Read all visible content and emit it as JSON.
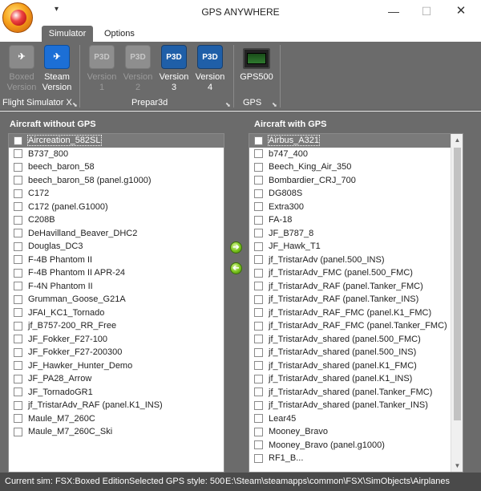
{
  "window": {
    "title": "GPS ANYWHERE",
    "qat_icon": "dropdown-arrow-icon",
    "minimize_icon": "—",
    "maximize_icon": "☐",
    "close_icon": "✕"
  },
  "tabs": [
    {
      "label": "Simulator"
    },
    {
      "label": "Options"
    }
  ],
  "ribbon": {
    "buttons": [
      {
        "label": "Boxed\nVersion",
        "line1": "Boxed",
        "line2": "Version",
        "icon": "plane-icon",
        "enabled": false
      },
      {
        "label": "Steam\nVersion",
        "line1": "Steam",
        "line2": "Version",
        "icon": "plane-icon",
        "enabled": true
      },
      {
        "label": "Version 1",
        "line1": "Version",
        "line2": "1",
        "icon": "p3d-icon",
        "badge": "P3D",
        "enabled": false
      },
      {
        "label": "Version 2",
        "line1": "Version",
        "line2": "2",
        "icon": "p3d-icon",
        "badge": "P3D",
        "enabled": false
      },
      {
        "label": "Version 3",
        "line1": "Version",
        "line2": "3",
        "icon": "p3d-icon",
        "badge": "P3D",
        "enabled": true
      },
      {
        "label": "Version 4",
        "line1": "Version",
        "line2": "4",
        "icon": "p3d-icon",
        "badge": "P3D",
        "enabled": true
      },
      {
        "label": "GPS500",
        "line1": "GPS500",
        "line2": "",
        "icon": "gps-device-icon",
        "enabled": true
      }
    ],
    "groups": [
      {
        "label": "Flight Simulator X"
      },
      {
        "label": "Prepar3d"
      },
      {
        "label": "GPS"
      }
    ]
  },
  "left_panel": {
    "title": "Aircraft without GPS",
    "items": [
      "Aircreation_582SL",
      "B737_800",
      "beech_baron_58",
      "beech_baron_58 (panel.g1000)",
      "C172",
      "C172 (panel.G1000)",
      "C208B",
      "DeHavilland_Beaver_DHC2",
      "Douglas_DC3",
      "F-4B Phantom II",
      "F-4B Phantom II APR-24",
      "F-4N Phantom II",
      "Grumman_Goose_G21A",
      "JFAI_KC1_Tornado",
      "jf_B757-200_RR_Free",
      "JF_Fokker_F27-100",
      "JF_Fokker_F27-200300",
      "JF_Hawker_Hunter_Demo",
      "JF_PA28_Arrow",
      "JF_TornadoGR1",
      "jf_TristarAdv_RAF (panel.K1_INS)",
      "Maule_M7_260C",
      "Maule_M7_260C_Ski"
    ],
    "selected_index": 0
  },
  "right_panel": {
    "title": "Aircraft with GPS",
    "items": [
      "Airbus_A321",
      "b747_400",
      "Beech_King_Air_350",
      "Bombardier_CRJ_700",
      "DG808S",
      "Extra300",
      "FA-18",
      "JF_B787_8",
      "JF_Hawk_T1",
      "jf_TristarAdv (panel.500_INS)",
      "jf_TristarAdv_FMC (panel.500_FMC)",
      "jf_TristarAdv_RAF (panel.Tanker_FMC)",
      "jf_TristarAdv_RAF (panel.Tanker_INS)",
      "jf_TristarAdv_RAF_FMC (panel.K1_FMC)",
      "jf_TristarAdv_RAF_FMC (panel.Tanker_FMC)",
      "jf_TristarAdv_shared (panel.500_FMC)",
      "jf_TristarAdv_shared (panel.500_INS)",
      "jf_TristarAdv_shared (panel.K1_FMC)",
      "jf_TristarAdv_shared (panel.K1_INS)",
      "jf_TristarAdv_shared (panel.Tanker_FMC)",
      "jf_TristarAdv_shared (panel.Tanker_INS)",
      "Lear45",
      "Mooney_Bravo",
      "Mooney_Bravo (panel.g1000)",
      "RF1_B..."
    ],
    "selected_index": 0
  },
  "move_buttons": {
    "add_icon": "arrow-right-circle-icon",
    "remove_icon": "arrow-left-circle-icon",
    "add_glyph": "➔",
    "remove_glyph": "➔"
  },
  "status": {
    "current_sim": "Current sim: FSX:Boxed Edition",
    "gps_style": "Selected GPS style: 500",
    "path": "E:\\Steam\\steamapps\\common\\FSX\\SimObjects\\Airplanes"
  },
  "colors": {
    "ribbon_bg": "#6b6b6b",
    "accent_blue": "#1c6fd6",
    "status_bg": "#4a4a4a"
  }
}
